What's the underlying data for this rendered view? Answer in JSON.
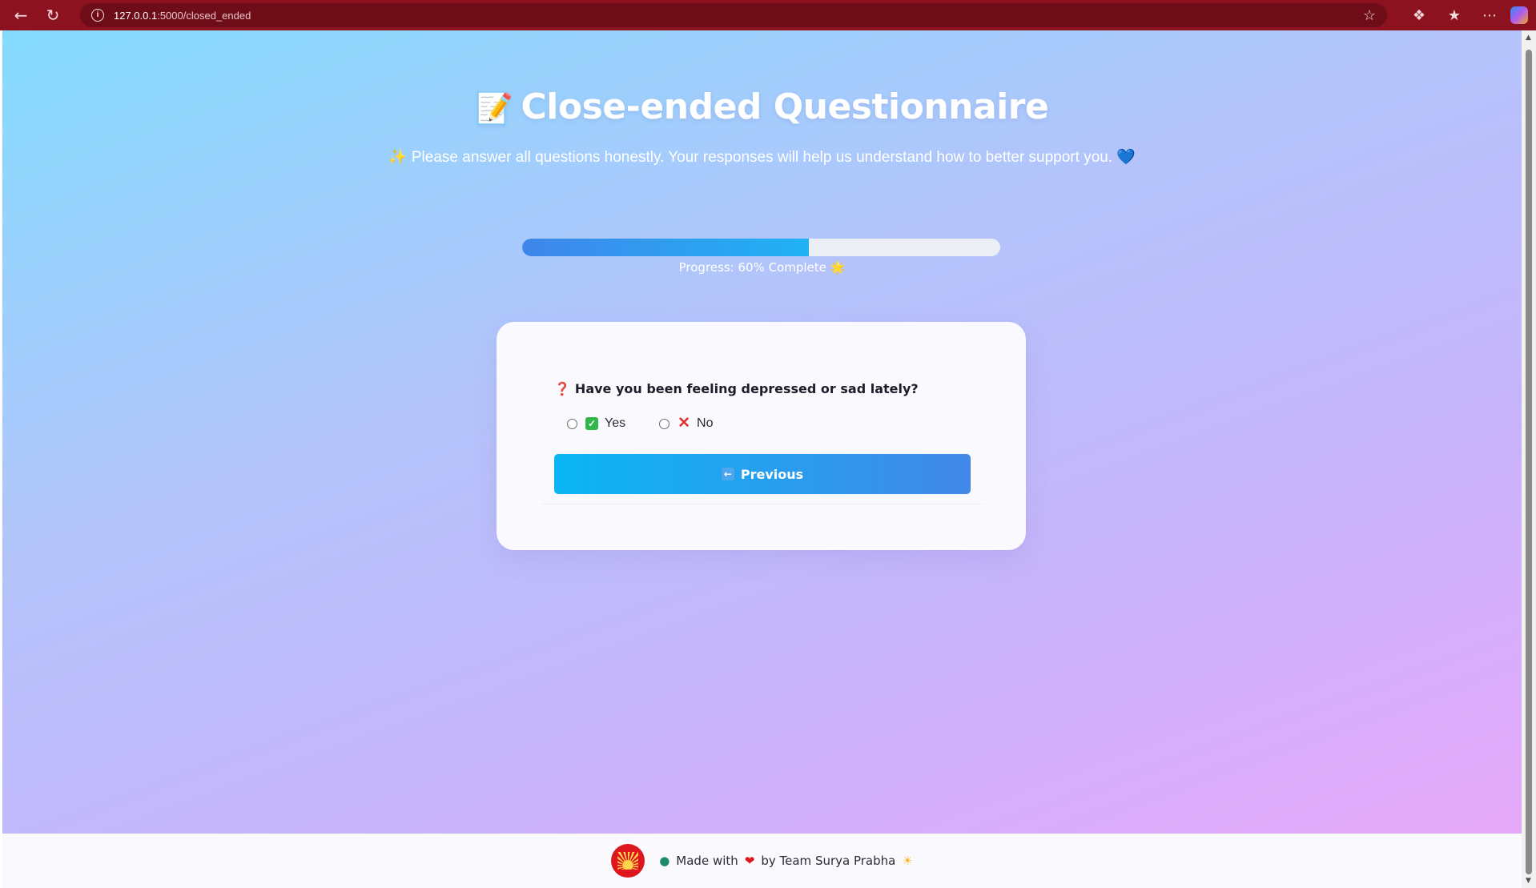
{
  "browser": {
    "url_host": "127.0.0.1",
    "url_path": ":5000/closed_ended"
  },
  "page": {
    "title_emoji": "📝",
    "title": "Close-ended Questionnaire",
    "subtitle_prefix": "✨",
    "subtitle": "Please answer all questions honestly. Your responses will help us understand how to better support you.",
    "subtitle_suffix": "💙"
  },
  "progress": {
    "percent": 60,
    "label": "Progress: 60% Complete",
    "label_emoji": "🌟"
  },
  "question": {
    "icon": "❓",
    "text": "Have you been feeling depressed or sad lately?",
    "options": [
      {
        "label": "Yes",
        "icon": "check-mark-icon"
      },
      {
        "label": "No",
        "icon": "cross-mark-icon"
      }
    ]
  },
  "buttons": {
    "previous_label": "Previous"
  },
  "footer": {
    "made_with": "Made with",
    "by_team": "by Team Surya Prabha"
  },
  "colors": {
    "accent": "#20b2f5",
    "browser_frame": "#8c1220"
  }
}
